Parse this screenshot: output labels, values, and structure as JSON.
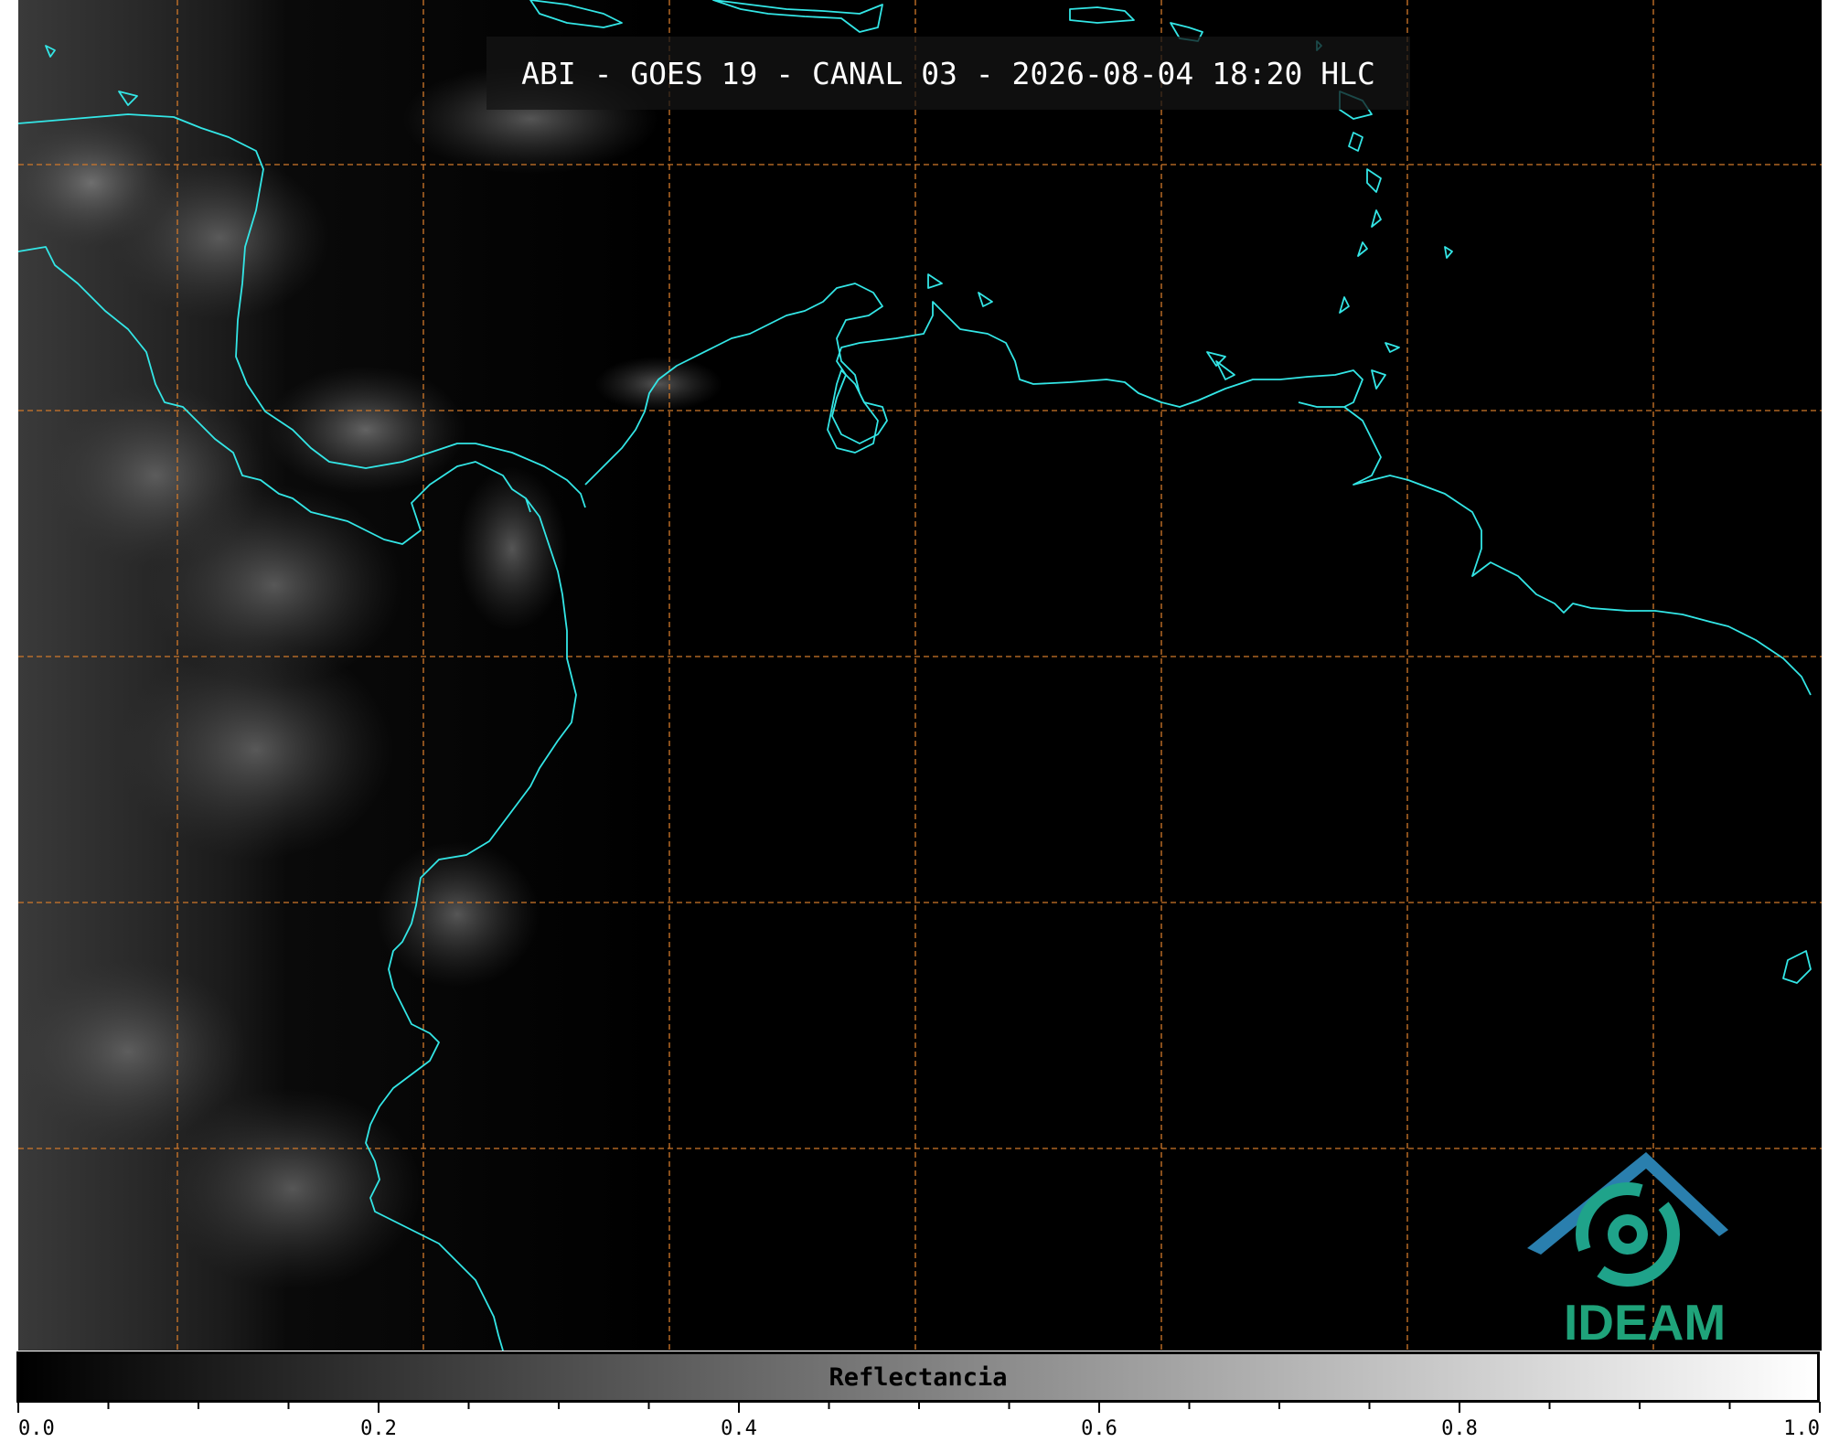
{
  "title": "ABI - GOES 19 - CANAL 03 - 2026-08-04 18:20 HLC",
  "colorbar": {
    "label": "Reflectancia",
    "ticks": [
      "0.0",
      "0.2",
      "0.4",
      "0.6",
      "0.8",
      "1.0"
    ],
    "min": 0.0,
    "max": 1.0,
    "colormap": "gray"
  },
  "logo": {
    "text": "IDEAM",
    "color": "#1fa37a",
    "accent": "#2a6fb0"
  },
  "colors": {
    "coastline": "#33e6e6",
    "graticule": "#d0782a",
    "background": "#000000"
  }
}
